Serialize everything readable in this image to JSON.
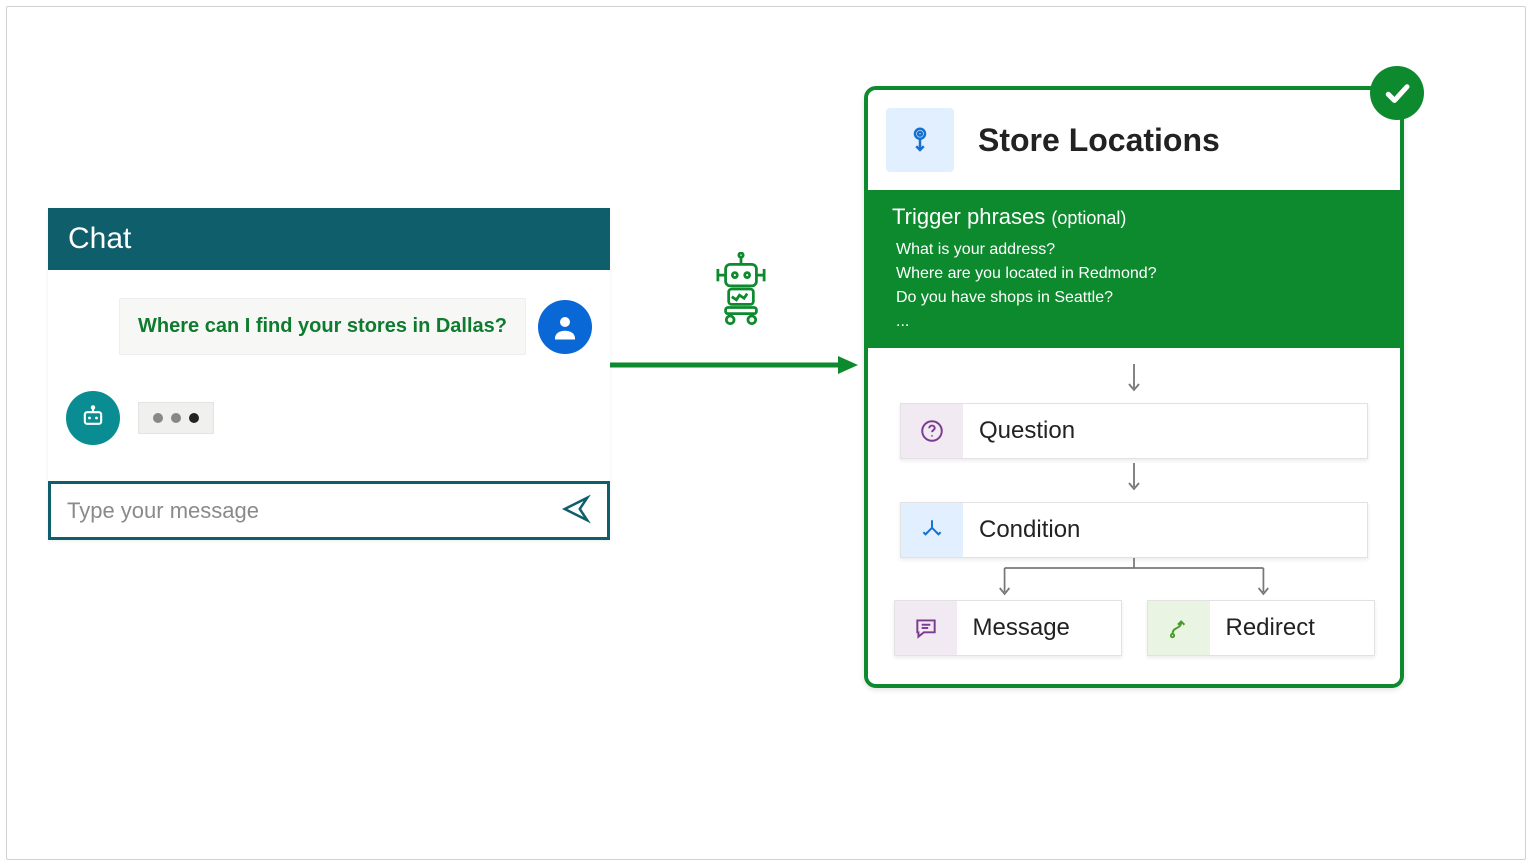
{
  "chat": {
    "header": "Chat",
    "user_message": "Where can I find your stores in Dallas?",
    "input_placeholder": "Type your message"
  },
  "topic": {
    "title": "Store Locations",
    "trigger_label": "Trigger phrases",
    "trigger_optional": "(optional)",
    "trigger_phrases": [
      "What is your address?",
      "Where are you located in Redmond?",
      "Do you have shops in Seattle?",
      "..."
    ]
  },
  "nodes": {
    "question": "Question",
    "condition": "Condition",
    "message": "Message",
    "redirect": "Redirect"
  }
}
